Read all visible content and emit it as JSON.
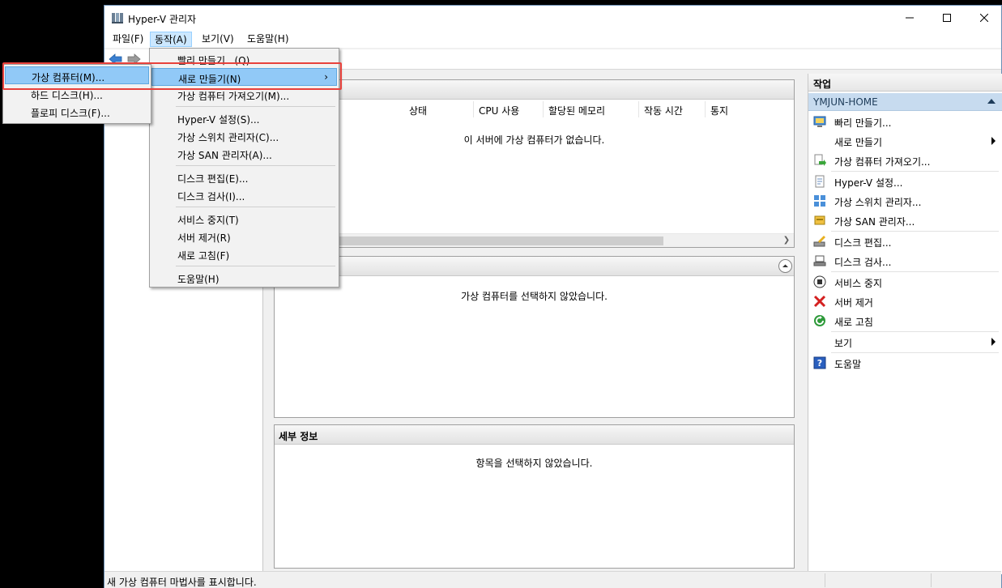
{
  "window": {
    "title": "Hyper-V 관리자",
    "controls": {
      "minimize": "minimize-icon",
      "maximize": "maximize-icon",
      "close": "close-icon"
    }
  },
  "menubar": {
    "items": [
      {
        "label": "파일(F)"
      },
      {
        "label": "동작(A)"
      },
      {
        "label": "보기(V)"
      },
      {
        "label": "도움말(H)"
      }
    ]
  },
  "toolbar": {
    "back_icon": "back-arrow-icon",
    "forward_icon": "forward-arrow-icon"
  },
  "vm_panel": {
    "columns": [
      "상태",
      "CPU 사용",
      "할당된 메모리",
      "작동 시간",
      "통지"
    ],
    "empty_message": "이 서버에 가상 컴퓨터가 없습니다."
  },
  "checkpoint_panel": {
    "empty_message": "가상 컴퓨터를 선택하지 않았습니다."
  },
  "details_panel": {
    "title": "세부 정보",
    "empty_message": "항목을 선택하지 않았습니다."
  },
  "actions": {
    "title": "작업",
    "section": "YMJUN-HOME",
    "items": [
      {
        "label": "빠리 만들기...",
        "icon": "quick-create-icon"
      },
      {
        "label": "새로 만들기",
        "icon": "",
        "submenu": true
      },
      {
        "label": "가상 컴퓨터 가져오기...",
        "icon": "import-vm-icon"
      },
      {
        "label": "Hyper-V 설정...",
        "icon": "settings-doc-icon"
      },
      {
        "label": "가상 스위치 관리자...",
        "icon": "virtual-switch-icon"
      },
      {
        "label": "가상 SAN 관리자...",
        "icon": "virtual-san-icon"
      },
      {
        "label": "디스크 편집...",
        "icon": "edit-disk-icon"
      },
      {
        "label": "디스크 검사...",
        "icon": "inspect-disk-icon"
      },
      {
        "label": "서비스 중지",
        "icon": "stop-service-icon"
      },
      {
        "label": "서버 제거",
        "icon": "remove-server-icon"
      },
      {
        "label": "새로 고침",
        "icon": "refresh-icon"
      },
      {
        "label": "보기",
        "icon": "",
        "submenu": true
      },
      {
        "label": "도움말",
        "icon": "help-icon"
      }
    ]
  },
  "action_menu": {
    "items": [
      {
        "label": "빨리 만들기...(Q)"
      },
      {
        "label": "새로 만들기(N)"
      },
      {
        "label": "가상 컴퓨터 가져오기(M)..."
      },
      {
        "label": "Hyper-V 설정(S)..."
      },
      {
        "label": "가상 스위치 관리자(C)..."
      },
      {
        "label": "가상 SAN 관리자(A)..."
      },
      {
        "label": "디스크 편집(E)..."
      },
      {
        "label": "디스크 검사(I)..."
      },
      {
        "label": "서비스 중지(T)"
      },
      {
        "label": "서버 제거(R)"
      },
      {
        "label": "새로 고침(F)"
      },
      {
        "label": "도움말(H)"
      }
    ]
  },
  "new_submenu": {
    "items": [
      {
        "label": "가상 컴퓨터(M)..."
      },
      {
        "label": "하드 디스크(H)..."
      },
      {
        "label": "플로피 디스크(F)..."
      }
    ]
  },
  "statusbar": {
    "text": "새 가상 컴퓨터 마법사를 표시합니다."
  },
  "colors": {
    "highlight": "#91c9f7",
    "annotation_red": "#e8413c",
    "section_blue": "#c7dbef"
  }
}
